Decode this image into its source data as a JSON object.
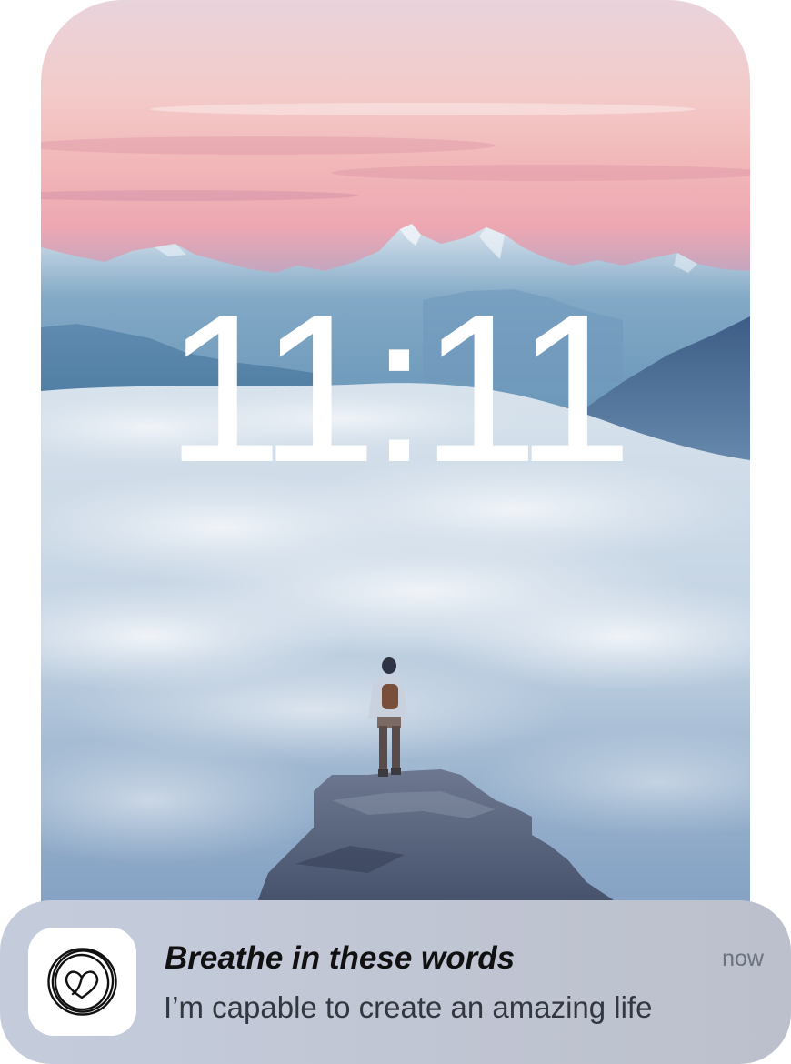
{
  "lock_screen": {
    "time": "11:11",
    "wallpaper": "mountain-summit-above-clouds"
  },
  "notification": {
    "app_icon": "spiral-heart-icon",
    "title": "Breathe in these words",
    "body": "I’m capable to create an amazing life",
    "timestamp": "now"
  },
  "colors": {
    "sky_top": "#f0cfd6",
    "sky_pink": "#f1a9b7",
    "mountain": "#5f8fb2",
    "cloud": "#e8eef5",
    "rock": "#48546c",
    "notification_bg": "#c1c6d4"
  }
}
